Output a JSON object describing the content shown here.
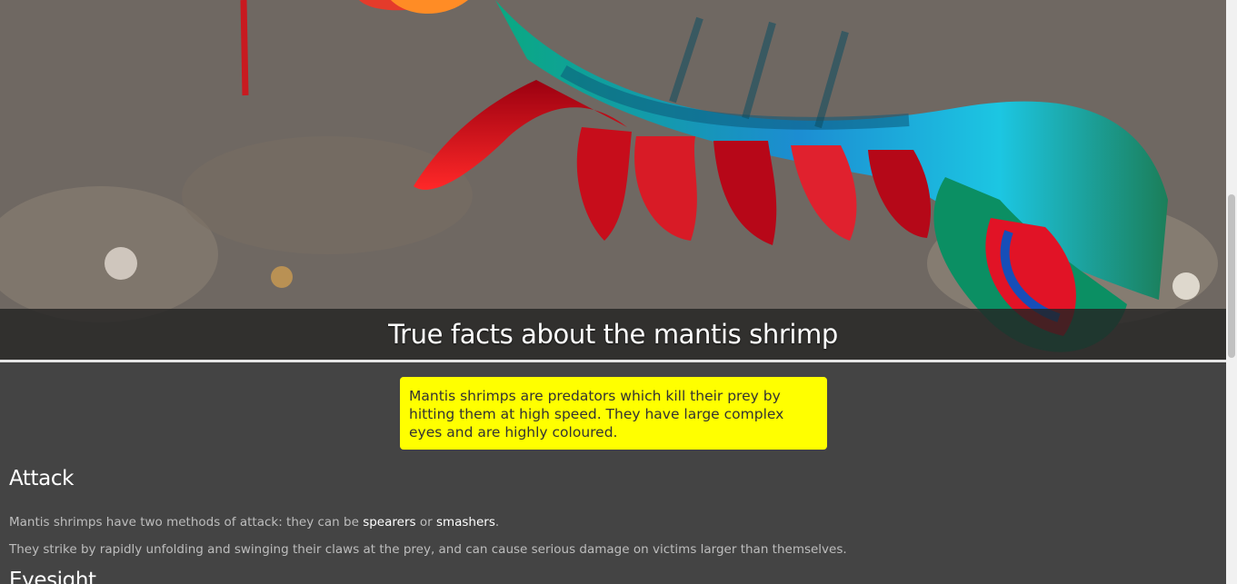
{
  "hero": {
    "title": "True facts about the mantis shrimp",
    "image_description": "colourful mantis shrimp on sandy sea floor"
  },
  "intro": {
    "text": "Mantis shrimps are predators which kill their prey by hitting them at high speed. They have large complex eyes and are highly coloured."
  },
  "attack": {
    "heading": "Attack",
    "paragraph1_before": "Mantis shrimps have two methods of attack: they can be ",
    "spearers": "spearers",
    "paragraph1_middle": " or ",
    "smashers": "smashers",
    "paragraph1_after": ".",
    "paragraph2": "They strike by rapidly unfolding and swinging their claws at the prey, and can cause serious damage on victims larger than themselves."
  },
  "eyesight": {
    "heading": "Eyesight"
  },
  "colors": {
    "page_background": "#444444",
    "highlight_box": "#ffff00",
    "heading_text": "#ffffff",
    "body_text": "#bdbdbd"
  }
}
